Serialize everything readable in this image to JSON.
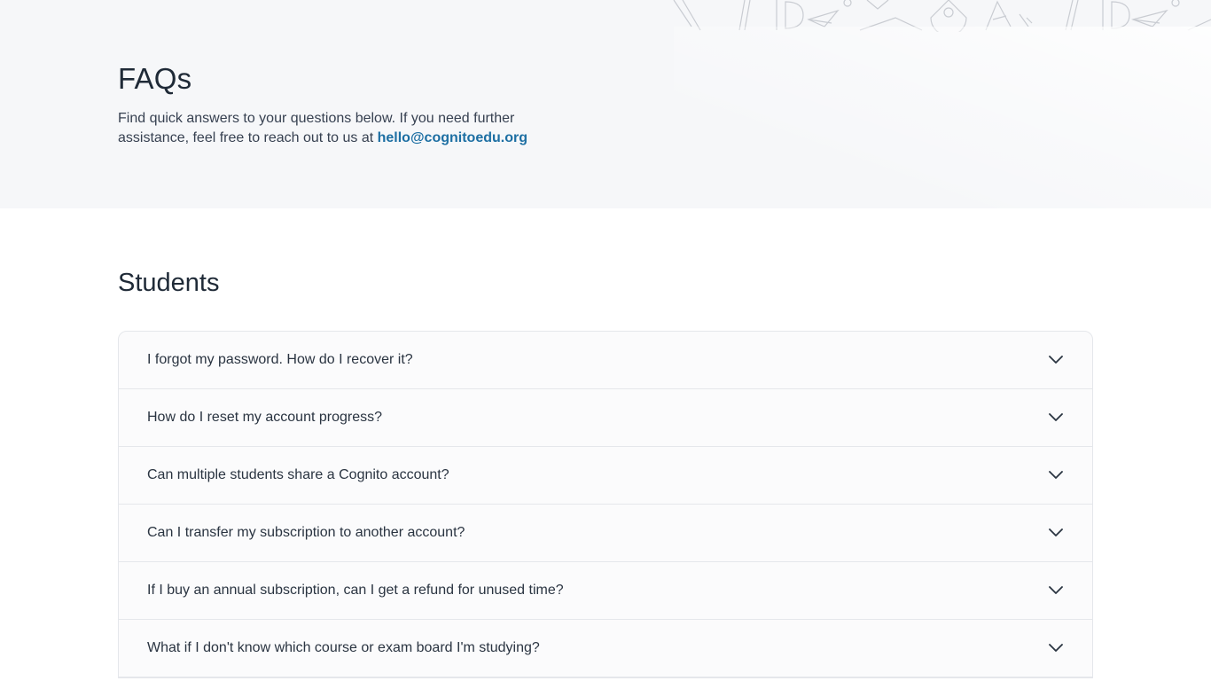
{
  "hero": {
    "title": "FAQs",
    "description": "Find quick answers to your questions below. If you need further assistance, feel free to reach out to us at ",
    "email": "hello@cognitoedu.org"
  },
  "section": {
    "title": "Students"
  },
  "faqs": [
    {
      "question": "I forgot my password. How do I recover it?",
      "icon": "chevron-down-icon"
    },
    {
      "question": "How do I reset my account progress?",
      "icon": "chevron-down-icon"
    },
    {
      "question": "Can multiple students share a Cognito account?",
      "icon": "chevron-down-icon"
    },
    {
      "question": "Can I transfer my subscription to another account?",
      "icon": "chevron-down-icon"
    },
    {
      "question": "If I buy an annual subscription, can I get a refund for unused time?",
      "icon": "chevron-down-icon"
    },
    {
      "question": "What if I don't know which course or exam board I'm studying?",
      "icon": "chevron-down-icon"
    }
  ],
  "colors": {
    "hero_bg": "#f6f7f9",
    "link": "#1d6fa3",
    "border": "#e5e7eb"
  }
}
